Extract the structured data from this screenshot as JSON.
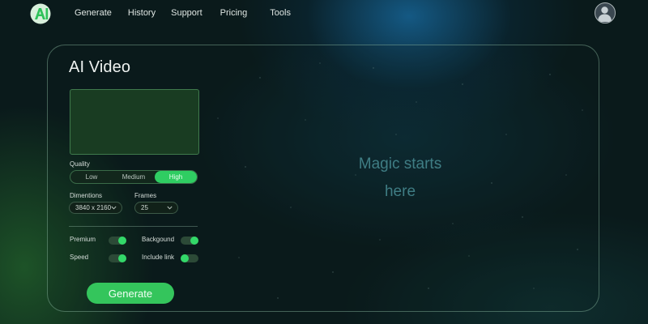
{
  "logo": {
    "icon": "ai-logo-icon",
    "letters": "AI",
    "color": "#2fc25a"
  },
  "nav": {
    "items": [
      {
        "label": "Generate"
      },
      {
        "label": "History"
      },
      {
        "label": "Support"
      },
      {
        "label": "Pricing"
      },
      {
        "label": "Tools"
      }
    ]
  },
  "user": {
    "avatar_icon": "user-avatar-icon"
  },
  "panel": {
    "title": "AI Video",
    "quality": {
      "label": "Quality",
      "options": [
        "Low",
        "Medium",
        "High"
      ],
      "selected": "High"
    },
    "dimensions": {
      "label": "Dimentions",
      "value": "3840 x 2160"
    },
    "frames": {
      "label": "Frames",
      "value": "25"
    },
    "toggles": [
      {
        "label": "Premium",
        "on": true
      },
      {
        "label": "Backgound",
        "on": true
      },
      {
        "label": "Speed",
        "on": true
      },
      {
        "label": "Include link",
        "on": false
      }
    ],
    "generate_label": "Generate"
  },
  "output": {
    "line1": "Magic starts",
    "line2": "here"
  },
  "colors": {
    "accent": "#2fcd62",
    "button": "#34c55c",
    "background": "#0a1a1b",
    "placeholder_text": "#3f7d84"
  }
}
